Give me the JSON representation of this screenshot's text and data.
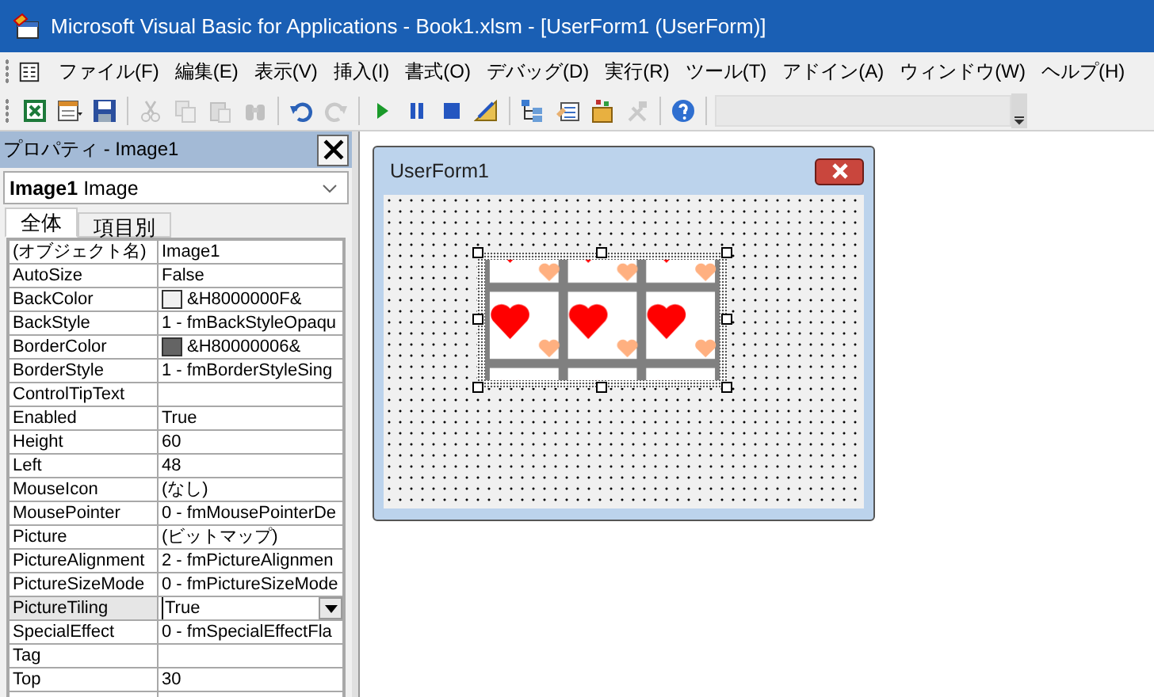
{
  "window": {
    "title": "Microsoft Visual Basic for Applications - Book1.xlsm - [UserForm1 (UserForm)]"
  },
  "menu": [
    "ファイル(F)",
    "編集(E)",
    "表示(V)",
    "挿入(I)",
    "書式(O)",
    "デバッグ(D)",
    "実行(R)",
    "ツール(T)",
    "アドイン(A)",
    "ウィンドウ(W)",
    "ヘルプ(H)"
  ],
  "toolbar_groups": [
    [
      {
        "kind": "excel",
        "disabled": false
      },
      {
        "kind": "insert-form",
        "disabled": false
      },
      {
        "kind": "save",
        "disabled": false
      }
    ],
    [
      {
        "kind": "cut",
        "disabled": true
      },
      {
        "kind": "copy",
        "disabled": true
      },
      {
        "kind": "paste",
        "disabled": true
      },
      {
        "kind": "find",
        "disabled": true
      }
    ],
    [
      {
        "kind": "undo",
        "disabled": false
      },
      {
        "kind": "redo",
        "disabled": true
      }
    ],
    [
      {
        "kind": "run",
        "disabled": false
      },
      {
        "kind": "pause",
        "disabled": false
      },
      {
        "kind": "stop",
        "disabled": false
      },
      {
        "kind": "design",
        "disabled": false
      }
    ],
    [
      {
        "kind": "explorer",
        "disabled": false
      },
      {
        "kind": "properties",
        "disabled": false
      },
      {
        "kind": "browser",
        "disabled": false
      },
      {
        "kind": "toolbox",
        "disabled": true
      }
    ],
    [
      {
        "kind": "help",
        "disabled": false
      }
    ]
  ],
  "properties": {
    "title": "プロパティ - Image1",
    "object": "**Image1** Image",
    "tabs": [
      {
        "label": "全体",
        "selected": true
      },
      {
        "label": "項目別",
        "selected": false
      }
    ],
    "rows": [
      {
        "name": "(オブジェクト名)",
        "value": "Image1",
        "selected": false
      },
      {
        "name": "AutoSize",
        "value": "False",
        "selected": false
      },
      {
        "name": "BackColor",
        "value": "&H8000000F&",
        "color": "#f0f0f0",
        "selected": false
      },
      {
        "name": "BackStyle",
        "value": "1 - fmBackStyleOpaqu",
        "selected": false
      },
      {
        "name": "BorderColor",
        "value": "&H80000006&",
        "color": "#646464",
        "selected": false
      },
      {
        "name": "BorderStyle",
        "value": "1 - fmBorderStyleSing",
        "selected": false
      },
      {
        "name": "ControlTipText",
        "value": "",
        "selected": false
      },
      {
        "name": "Enabled",
        "value": "True",
        "selected": false
      },
      {
        "name": "Height",
        "value": "60",
        "selected": false
      },
      {
        "name": "Left",
        "value": "48",
        "selected": false
      },
      {
        "name": "MouseIcon",
        "value": "(なし)",
        "selected": false
      },
      {
        "name": "MousePointer",
        "value": "0 - fmMousePointerDe",
        "selected": false
      },
      {
        "name": "Picture",
        "value": "(ビットマップ)",
        "selected": false
      },
      {
        "name": "PictureAlignment",
        "value": "2 - fmPictureAlignmen",
        "selected": false
      },
      {
        "name": "PictureSizeMode",
        "value": "0 - fmPictureSizeMode",
        "selected": false
      },
      {
        "name": "PictureTiling",
        "value": "True",
        "selected": true
      },
      {
        "name": "SpecialEffect",
        "value": "0 - fmSpecialEffectFla",
        "selected": false
      },
      {
        "name": "Tag",
        "value": "",
        "selected": false
      },
      {
        "name": "Top",
        "value": "30",
        "selected": false
      }
    ]
  },
  "form": {
    "title": "UserForm1"
  }
}
